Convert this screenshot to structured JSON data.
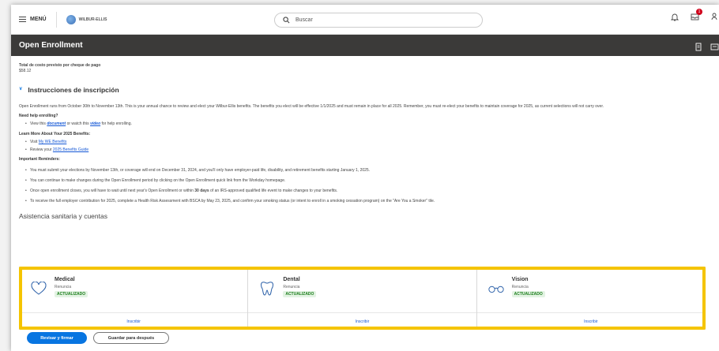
{
  "topbar": {
    "menu_label": "MENÚ",
    "logo_text": "WILBUR-ELLIS",
    "search_placeholder": "Buscar",
    "notification_count": "1"
  },
  "header": {
    "title": "Open Enrollment"
  },
  "cost": {
    "label": "Total de costo previsto por cheque de pago",
    "value": "$58.12"
  },
  "instructions": {
    "title": "Instrucciones de inscripción",
    "intro": "Open Enrollment runs from October 30th to November 13th. This is your annual chance to review and elect your Wilbur-Ellis benefits. The benefits you elect will be effective 1/1/2025 and must remain in place for all 2025. Remember, you must re-elect your benefits to maintain coverage for 2025, as current selections will not carry over.",
    "help_heading": "Need help enrolling?",
    "help_pre": "View this ",
    "help_doc": "document",
    "help_mid": " or watch this ",
    "help_video": "video",
    "help_post": " for help enrolling.",
    "learn_heading": "Learn More About Your 2025 Benefits:",
    "learn_visit_pre": "Visit ",
    "learn_visit_link": "My WE Benefits",
    "learn_review_pre": "Review your ",
    "learn_review_link": "2025 Benefits Guide",
    "reminders_heading": "Important Reminders:",
    "reminder1": "You must submit your elections by November 13th, or coverage will end on December 31, 2024, and you'll only have employer-paid life, disability, and retirement benefits starting January 1, 2025.",
    "reminder2": "You can continue to make changes during the Open Enrollment period by clicking on the Open Enrollment quick link from the Workday homepage.",
    "reminder3_pre": "Once open enrollment closes, you will have to wait until next year's Open Enrollment or within ",
    "reminder3_bold": "30 days",
    "reminder3_post": " of an IRS-approved qualified life event to make changes to your benefits.",
    "reminder4": "To receive the full employer contribution for 2025, complete a Health Risk Assessment with BSCA by May 23, 2025, and confirm your smoking status (or intent to enroll in a smoking cessation program) on the \"Are You a Smoker\" tile."
  },
  "health": {
    "title": "Asistencia sanitaria y cuentas",
    "cards": [
      {
        "name": "Medical",
        "status": "Renuncia",
        "tag": "ACTUALIZADO",
        "button": "Inscribir",
        "icon": "heart-icon"
      },
      {
        "name": "Dental",
        "status": "Renuncia",
        "tag": "ACTUALIZADO",
        "button": "Inscribir",
        "icon": "tooth-icon"
      },
      {
        "name": "Vision",
        "status": "Renuncia",
        "tag": "ACTUALIZADO",
        "button": "Inscribir",
        "icon": "glasses-icon"
      }
    ]
  },
  "actions": {
    "primary": "Revisar y firmar",
    "secondary": "Guardar para después"
  },
  "colors": {
    "primary_blue": "#0875e1",
    "header_bg": "#3b3a39",
    "highlight": "#f5c400",
    "tag_green": "#1a7d1a"
  }
}
